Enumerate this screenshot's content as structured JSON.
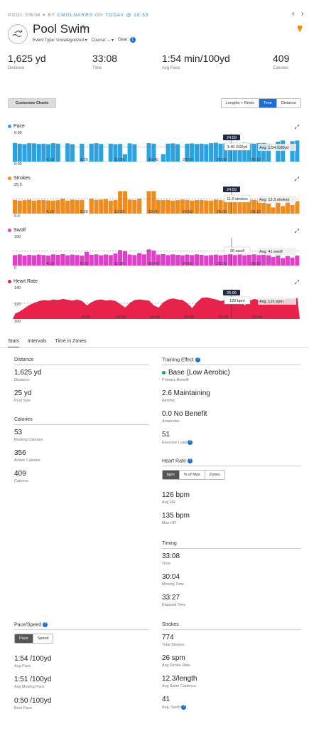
{
  "header": {
    "breadcrumb_prefix": "POOL SWIM",
    "breadcrumb_by": " BY ",
    "user": "CMOLNARRS",
    "breadcrumb_on": " ON ",
    "date": "TODAY @ 10:53",
    "prev_icon": "chevron-left-icon",
    "next_icon": "chevron-right-icon",
    "trophy_icon": "trophy-icon",
    "trophy_color": "#f08c00",
    "title": "Pool Swim",
    "event_type": "Event Type: Uncategorized",
    "course": "Course: --",
    "gear": "Gear:",
    "gear_count": "1"
  },
  "summary": [
    {
      "value": "1,625 yd",
      "label": "Distance"
    },
    {
      "value": "33:08",
      "label": "Time"
    },
    {
      "value": "1:54 min/100yd",
      "label": "Avg Pace"
    },
    {
      "value": "409",
      "label": "Calories"
    }
  ],
  "controls": {
    "customize": "Customize Charts",
    "views": [
      "Lengths + Rests",
      "Time",
      "Distance"
    ],
    "active_view": "Time"
  },
  "chart_data": [
    {
      "type": "bar",
      "title": "Pace",
      "color": "#2aa3e0",
      "ylabel_top": "0.00",
      "ylabel_bottom": "0:00",
      "x_ticks": [
        "4:10",
        "8:20",
        "12:30",
        "16:40",
        "20:50",
        "25:00",
        "29:10"
      ],
      "cursor_label": "24:59",
      "cursor_value": "1:40 /100yd",
      "avg_label": "Avg: 1:54 /100yd",
      "values": [
        0.75,
        0.72,
        0.7,
        0.74,
        0.73,
        0.71,
        0.72,
        0.7,
        0.74,
        0.72,
        0,
        0.73,
        0.7,
        0,
        0.72,
        0,
        0.72,
        0.74,
        0.71,
        0,
        0.72,
        0.7,
        0.71,
        0.3,
        0.73,
        0.7,
        0,
        0,
        0.74,
        0.72,
        0,
        0.3,
        0.72,
        0.73,
        0.7,
        0,
        0.72,
        0.73,
        0.71,
        0.72,
        0.7,
        0.74,
        0.76,
        0.72,
        0.73,
        0.75,
        0.72,
        0.74,
        0.76,
        0.73,
        0.72,
        0.74,
        0.75,
        0.72,
        0,
        0.8,
        0.85,
        0,
        0.82,
        0.85
      ]
    },
    {
      "type": "bar",
      "title": "Strokes",
      "color": "#f08c1e",
      "ylabel_top": "25.0",
      "ylabel_bottom": "0.0",
      "x_ticks": [
        "4:10",
        "8:20",
        "12:30",
        "16:40",
        "20:50",
        "25:00",
        "29:10"
      ],
      "cursor_label": "24:59",
      "cursor_value": "11.0 strokes",
      "avg_label": "Avg: 12.3 strokes",
      "values": [
        0.55,
        0.52,
        0.54,
        0.56,
        0.52,
        0.54,
        0.55,
        0.53,
        0.52,
        0.54,
        0.6,
        0.52,
        0.56,
        0.54,
        0.55,
        0,
        0.6,
        0.55,
        0.56,
        0.58,
        0.52,
        0.54,
        0.9,
        0.9,
        0.56,
        0.55,
        0.6,
        0,
        0.9,
        0.9,
        0.55,
        0.54,
        0.55,
        0.52,
        0.54,
        0.56,
        0.55,
        0.52,
        0.54,
        0.55,
        0.53,
        0.52,
        0.56,
        0.54,
        0.52,
        0.55,
        0.53,
        0.54,
        0.52,
        0.56,
        0.55,
        0.53,
        0.52,
        0.4,
        0.25,
        0.45,
        0.3,
        0.5,
        0.35,
        0.5
      ]
    },
    {
      "type": "bar",
      "title": "Swolf",
      "color": "#e040c8",
      "ylabel_top": "100",
      "ylabel_bottom": "0",
      "x_ticks": [
        "4:10",
        "8:20",
        "12:30",
        "16:40",
        "20:50",
        "25:00",
        "29:10"
      ],
      "cursor_label": "",
      "cursor_value": "36 swolf",
      "avg_label": "Avg: 41 swolf",
      "values": [
        0.42,
        0.45,
        0.4,
        0.43,
        0.41,
        0.44,
        0.42,
        0.4,
        0.45,
        0.43,
        0.46,
        0.41,
        0.44,
        0.42,
        0.4,
        0.55,
        0.43,
        0.45,
        0.41,
        0.44,
        0.42,
        0.48,
        0.62,
        0.58,
        0.44,
        0.42,
        0.5,
        0.45,
        0.65,
        0.6,
        0.44,
        0.46,
        0.42,
        0.45,
        0.43,
        0.41,
        0.44,
        0.42,
        0.45,
        0.43,
        0.4,
        0.42,
        0.44,
        0.41,
        0.43,
        0.45,
        0.42,
        0.44,
        0.41,
        0.43,
        0.45,
        0.42,
        0.44,
        0.41,
        0.35,
        0.4,
        0.3,
        0.38,
        0.32,
        0.4
      ]
    },
    {
      "type": "area",
      "title": "Heart Rate",
      "color": "#e8224a",
      "ylabel_top": "140",
      "ylabel_mid": "120",
      "ylabel_bottom": "100",
      "x_ticks": [
        "8:20",
        "12:30",
        "16:40",
        "20:50",
        "25:00",
        "29:10"
      ],
      "cursor_label": "25:06",
      "cursor_value": "129 bpm",
      "avg_label": "Avg: 126 bpm",
      "values": [
        0.2,
        0.28,
        0.4,
        0.52,
        0.6,
        0.66,
        0.7,
        0.68,
        0.72,
        0.7,
        0.74,
        0.71,
        0.68,
        0.72,
        0.66,
        0.5,
        0.62,
        0.7,
        0.72,
        0.68,
        0.7,
        0.66,
        0.55,
        0.42,
        0.6,
        0.7,
        0.72,
        0.7,
        0.68,
        0.5,
        0.42,
        0.62,
        0.72,
        0.76,
        0.72,
        0.7,
        0.58,
        0.4,
        0.62,
        0.78,
        0.8,
        0.76,
        0.72,
        0.66,
        0.7,
        0.82,
        0.78,
        0.72,
        0.5,
        0.68,
        0.74,
        0.7,
        0.72,
        0.68,
        0.6,
        0.72,
        0.7,
        0.74,
        0.72,
        0.78
      ]
    }
  ],
  "tabs": [
    "Stats",
    "Intervals",
    "Time in Zones"
  ],
  "stats": {
    "distance_heading": "Distance",
    "distance": {
      "value": "1,625 yd",
      "label": "Distance"
    },
    "pool": {
      "value": "25 yd",
      "label": "Pool Size"
    },
    "calories_heading": "Calories",
    "resting": {
      "value": "53",
      "label": "Resting Calories"
    },
    "active": {
      "value": "356",
      "label": "Active Calories"
    },
    "calories": {
      "value": "409",
      "label": "Calories"
    },
    "training_heading": "Training Effect",
    "primary": {
      "value": "Base (Low Aerobic)",
      "label": "Primary Benefit"
    },
    "aerobic": {
      "value": "2.6 Maintaining",
      "label": "Aerobic"
    },
    "anaerobic": {
      "value": "0.0 No Benefit",
      "label": "Anaerobic"
    },
    "load": {
      "value": "51",
      "label": "Exercise Load"
    },
    "hr_heading": "Heart Rate",
    "hr_buttons": [
      "bpm",
      "% of Max",
      "Zones"
    ],
    "avg_hr": {
      "value": "126 bpm",
      "label": "Avg HR"
    },
    "max_hr": {
      "value": "135 bpm",
      "label": "Max HR"
    },
    "timing_heading": "Timing",
    "time": {
      "value": "33:08",
      "label": "Time"
    },
    "moving": {
      "value": "30:04",
      "label": "Moving Time"
    },
    "elapsed": {
      "value": "33:27",
      "label": "Elapsed Time"
    },
    "pace_heading": "Pace/Speed",
    "pace_buttons": [
      "Pace",
      "Speed"
    ],
    "avg_pace": {
      "value": "1:54 /100yd",
      "label": "Avg Pace"
    },
    "avg_moving_pace": {
      "value": "1:51 /100yd",
      "label": "Avg Moving Pace"
    },
    "best_pace": {
      "value": "0:50 /100yd",
      "label": "Best Pace"
    },
    "strokes_heading": "Strokes",
    "total_strokes": {
      "value": "774",
      "label": "Total Strokes"
    },
    "stroke_rate": {
      "value": "26 spm",
      "label": "Avg Stroke Rate"
    },
    "cadence": {
      "value": "12.3/length",
      "label": "Avg Swim Cadence"
    },
    "swolf": {
      "value": "41",
      "label": "Avg. Swolf"
    }
  }
}
